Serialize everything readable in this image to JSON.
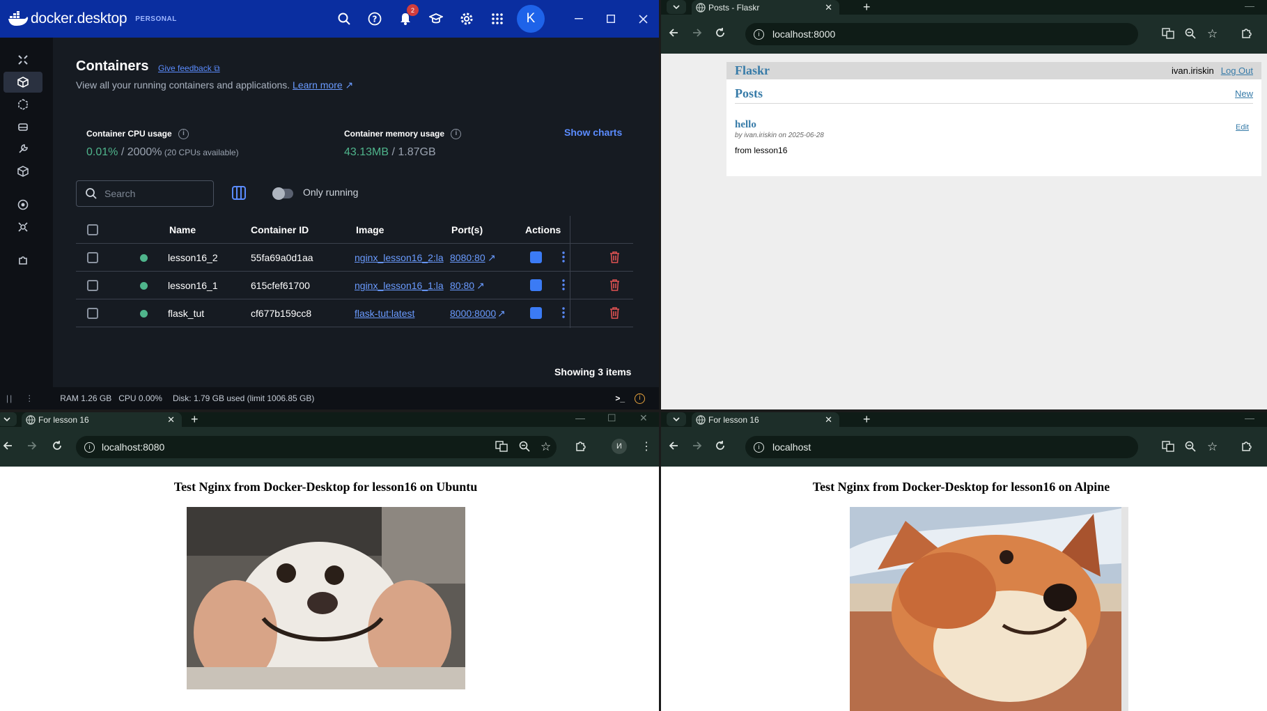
{
  "docker": {
    "brand": "docker desktop",
    "brand_bold": "docker",
    "brand_rest": ".desktop",
    "plan": "PERSONAL",
    "notif_count": "2",
    "avatar_letter": "K",
    "title": "Containers",
    "feedback": "Give feedback",
    "subtitle": "View all your running containers and applications.",
    "learn_more": "Learn more",
    "cpu_label": "Container CPU usage",
    "cpu_value": "0.01%",
    "cpu_total": " / 2000%",
    "cpu_note": " (20 CPUs available)",
    "mem_label": "Container memory usage",
    "mem_value": "43.13MB",
    "mem_total": " / 1.87GB",
    "show_charts": "Show charts",
    "search_placeholder": "Search",
    "only_running": "Only running",
    "columns": {
      "name": "Name",
      "id": "Container ID",
      "image": "Image",
      "ports": "Port(s)",
      "actions": "Actions"
    },
    "rows": [
      {
        "name": "lesson16_2",
        "id": "55fa69a0d1aa",
        "image": "nginx_lesson16_2:la",
        "ports": "8080:80"
      },
      {
        "name": "lesson16_1",
        "id": "615cfef61700",
        "image": "nginx_lesson16_1:la",
        "ports": "80:80"
      },
      {
        "name": "flask_tut",
        "id": "cf677b159cc8",
        "image": "flask-tut:latest",
        "ports": "8000:8000"
      }
    ],
    "showing": "Showing 3 items",
    "footer": {
      "ram": "RAM 1.26 GB",
      "cpu": "CPU 0.00%",
      "disk": "Disk: 1.79 GB used (limit 1006.85 GB)"
    },
    "accent": "#0a2ea0",
    "running_color": "#4fb58c"
  },
  "browser_flask": {
    "tab_title": "Posts - Flaskr",
    "url": "localhost:8000",
    "app": {
      "title": "Flaskr",
      "user": "ivan.iriskin",
      "logout": "Log Out",
      "posts_heading": "Posts",
      "new": "New",
      "post_title": "hello",
      "post_about": "by ivan.iriskin on 2025-06-28",
      "edit": "Edit",
      "post_body": "from lesson16"
    }
  },
  "browser_ubuntu": {
    "tab_title": "For lesson 16",
    "url": "localhost:8080",
    "profile_letter": "И",
    "heading": "Test Nginx from Docker-Desktop for lesson16 on Ubuntu"
  },
  "browser_alpine": {
    "tab_title": "For lesson 16",
    "url": "localhost",
    "heading": "Test Nginx from Docker-Desktop for lesson16 on Alpine"
  }
}
